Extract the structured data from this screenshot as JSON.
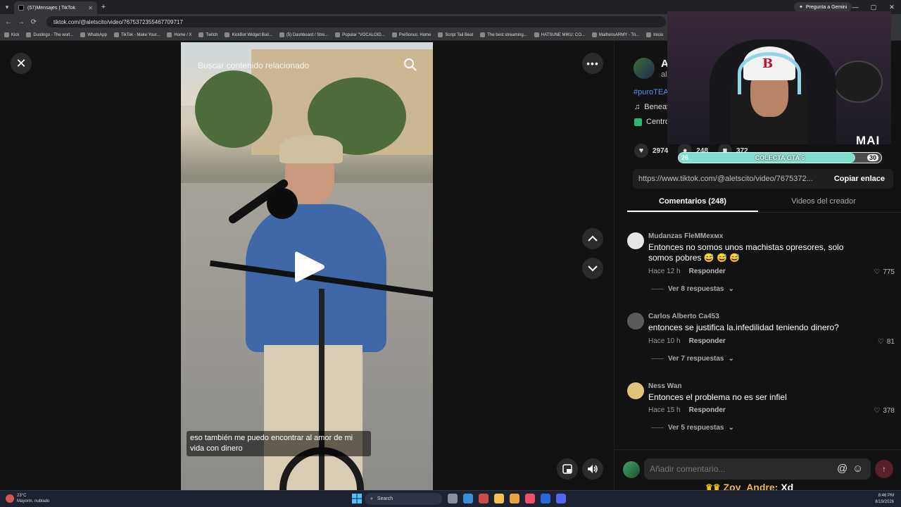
{
  "browser": {
    "tab_title": "(57)Mensajes | TikTok",
    "address": "tiktok.com/@aletscito/video/7675372355467709717",
    "gemini_label": "Pregunta a Gemini",
    "bookmarks": [
      "Kick",
      "Duolingo - The worl...",
      "WhatsApp",
      "TikTok - Make Your...",
      "Home / X",
      "Twitch",
      "KickBot Widget Buil...",
      "(5) Dashboard / Stre...",
      "Popular \"VOCALOID...",
      "PreSonus: Home",
      "Script Tail Beat",
      "The best streaming...",
      "HATSUNE MIKU: CO...",
      "MaifrensARMY - Tri...",
      "Inicio"
    ]
  },
  "video": {
    "search_placeholder": "Buscar contenido relacionado",
    "subtitle": "eso también me puedo encontrar al amor de mi vida con dinero"
  },
  "post": {
    "author_name": "A",
    "author_handle": "al",
    "hashtag": "#puroTEA",
    "music": "Beneat",
    "location": "Centro",
    "likes": "2974",
    "comments": "248",
    "saves": "372",
    "link": "https://www.tiktok.com/@aletscito/video/7675372...",
    "copy_label": "Copiar enlace"
  },
  "tabs": {
    "comments": "Comentarios (248)",
    "creator_videos": "Videos del creador"
  },
  "comments": [
    {
      "user": "Mudanzas FleMMexᴍx",
      "text": "Entonces no somos unos machistas opresores, solo somos pobres 😅 😅 😅",
      "time": "Hace 12 h",
      "reply": "Responder",
      "likes": "775",
      "replies": "Ver 8 respuestas",
      "avatar_color": "#e6e6e6"
    },
    {
      "user": "Carlos Alberto Ca453",
      "text": "entonces se justifica la.infedilidad teniendo dinero?",
      "time": "Hace 10 h",
      "reply": "Responder",
      "likes": "81",
      "replies": "Ver 7 respuestas",
      "avatar_color": "#5b5b5b"
    },
    {
      "user": "Ness Wan",
      "text": "Entonces el problema no es ser infiel",
      "time": "Hace 15 h",
      "reply": "Responder",
      "likes": "378",
      "replies": "Ver 5 respuestas",
      "avatar_color": "#e3c27a"
    }
  ],
  "input": {
    "placeholder": "Añadir comentario..."
  },
  "overlay": {
    "brand": "MAI",
    "goal_label": "COLECTA GTA 6",
    "goal_current": "26",
    "goal_max": "30",
    "goal_progress": 0.87,
    "chat_user": "Zoy_Andre:",
    "chat_message": "Xd"
  },
  "taskbar": {
    "temperature": "23°C",
    "weather": "Mayorm. nublado",
    "search_label": "Search",
    "time": "8:46 PM",
    "date": "8/19/2026"
  },
  "colors": {
    "accent_link": "#5b8df5",
    "goal_fill": "#7fe0d0",
    "send_button": "#5a1f2a"
  }
}
